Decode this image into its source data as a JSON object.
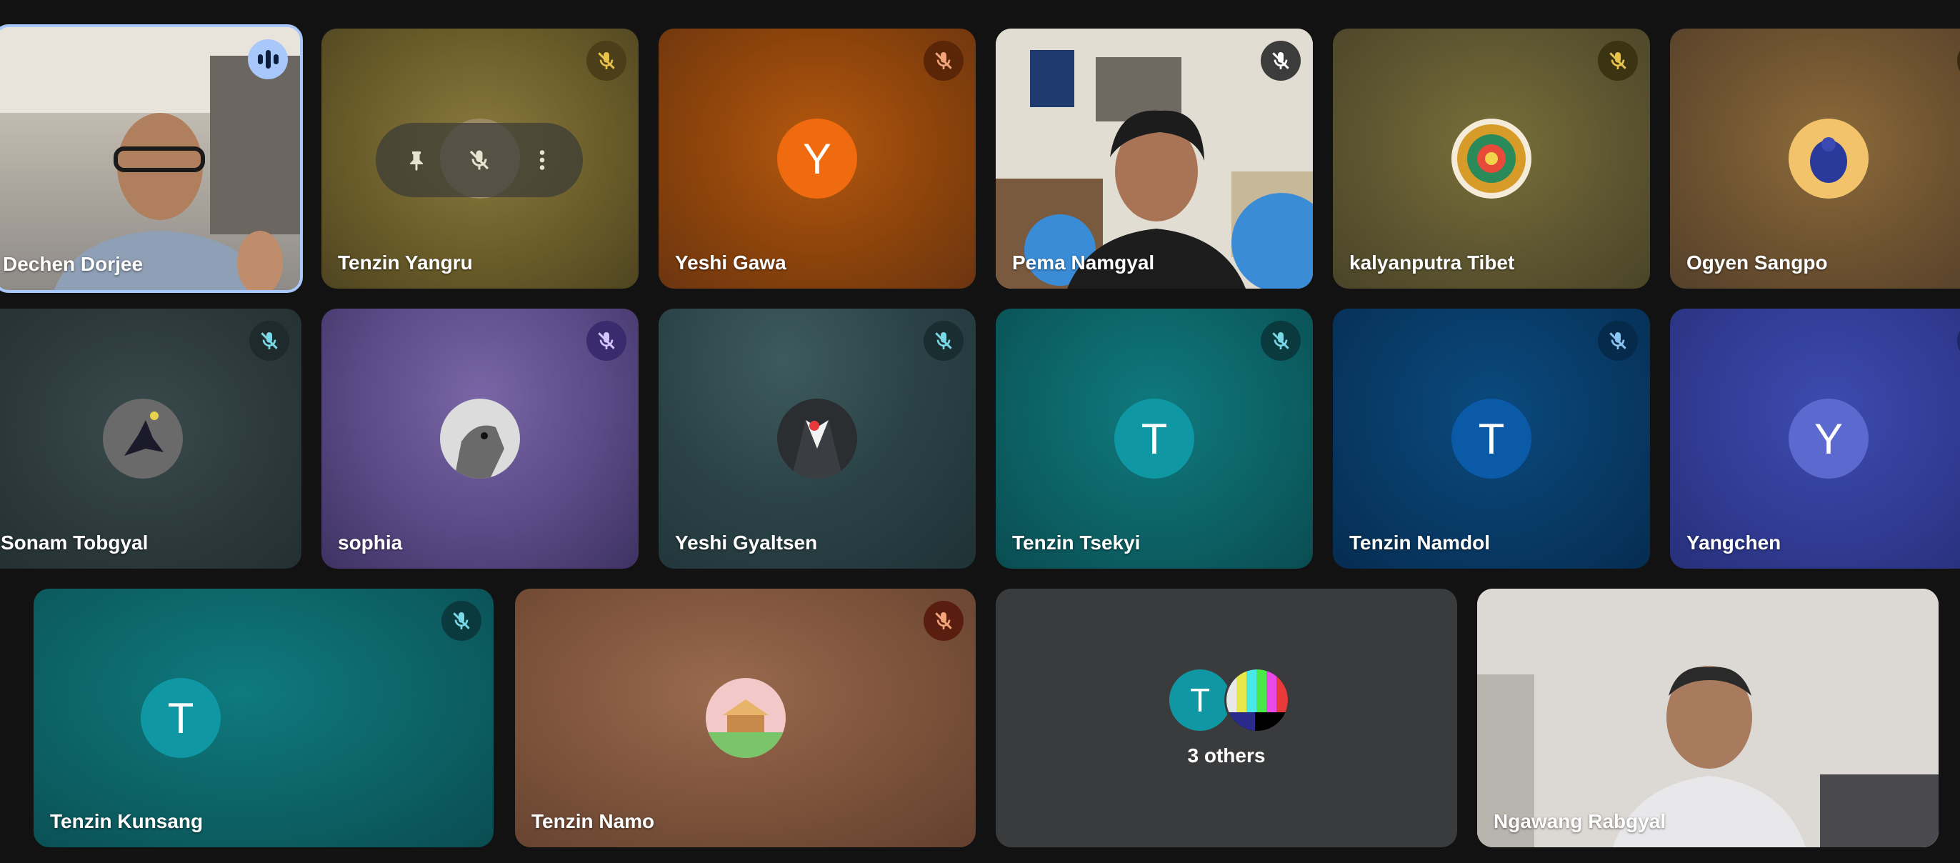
{
  "participants": [
    {
      "name": "Dechen Dorjee",
      "status": "speaking"
    },
    {
      "name": "Tenzin Yangru",
      "status": "muted"
    },
    {
      "name": "Yeshi Gawa",
      "status": "muted",
      "initial": "Y"
    },
    {
      "name": "Pema Namgyal",
      "status": "muted"
    },
    {
      "name": "kalyanputra Tibet",
      "status": "muted"
    },
    {
      "name": "Ogyen Sangpo",
      "status": "muted"
    },
    {
      "name": "Sonam Tobgyal",
      "status": "muted"
    },
    {
      "name": "sophia",
      "status": "muted"
    },
    {
      "name": "Yeshi Gyaltsen",
      "status": "muted"
    },
    {
      "name": "Tenzin Tsekyi",
      "status": "muted",
      "initial": "T"
    },
    {
      "name": "Tenzin Namdol",
      "status": "muted",
      "initial": "T"
    },
    {
      "name": "Yangchen",
      "status": "muted",
      "initial": "Y"
    },
    {
      "name": "Tenzin Kunsang",
      "status": "muted",
      "initial": "T"
    },
    {
      "name": "Tenzin Namo",
      "status": "muted"
    },
    {
      "name": "Ngawang Rabgyal",
      "status": "camera-on"
    }
  ],
  "others_tile": {
    "label": "3 others",
    "initial": "T"
  },
  "hover_controls": {
    "icons": [
      "pin-icon",
      "mic-off-icon",
      "more-vert-icon"
    ]
  },
  "colors": {
    "background": "#121212",
    "speaking_ring": "#a8c7fa",
    "orange_avatar": "#f06a0f",
    "teal_avatar": "#0f97a3"
  }
}
